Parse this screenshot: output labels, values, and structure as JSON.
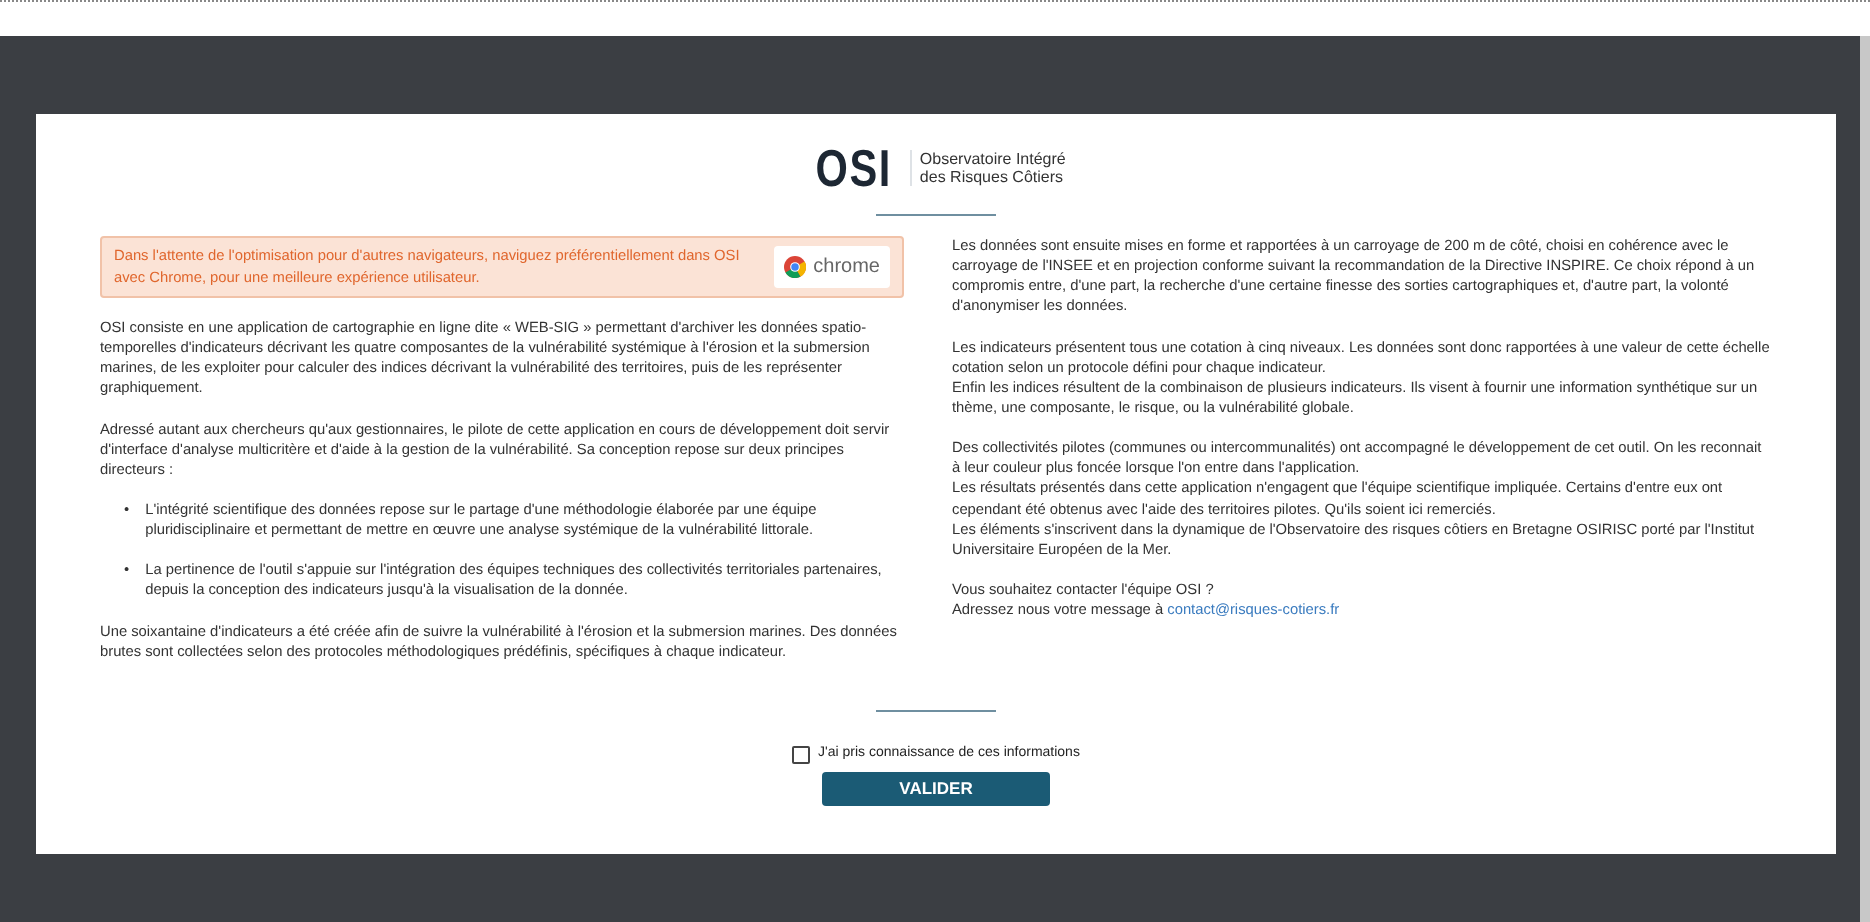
{
  "logo": {
    "acronym": "OSI",
    "name_line_1": "Observatoire Intégré",
    "name_line_2": "des Risques Côtiers"
  },
  "browser_notice": {
    "text": "Dans l'attente de l'optimisation pour d'autres navigateurs, naviguez préférentiellement dans OSI avec Chrome, pour une meilleure expérience utilisateur.",
    "badge": "chrome"
  },
  "left_column": [
    {
      "kind": "paragraph",
      "text": "OSI consiste en une application de cartographie en ligne dite « WEB-SIG » permettant d'archiver les données spatio-temporelles d'indicateurs décrivant les quatre composantes de la vulnérabilité systémique à l'érosion et la submersion marines, de les exploiter pour calculer des indices décrivant la vulnérabilité des territoires, puis de les représenter graphiquement."
    },
    {
      "kind": "paragraph",
      "text": "Adressé autant aux chercheurs qu'aux gestionnaires, le pilote de cette application en cours de développement doit servir d'interface d'analyse multicritère et d'aide à la gestion de la vulnérabilité. Sa conception repose sur deux principes directeurs :"
    },
    {
      "kind": "bullets",
      "marker": "•",
      "items": [
        "L'intégrité scientifique des données repose sur le partage d'une méthodologie élaborée par une équipe pluridisciplinaire et permettant de mettre en œuvre une analyse systémique de la vulnérabilité littorale.",
        "La pertinence de l'outil s'appuie sur l'intégration des équipes techniques des collectivités territoriales partenaires, depuis la conception des indicateurs jusqu'à la visualisation de la donnée."
      ]
    },
    {
      "kind": "paragraph",
      "text": "Une soixantaine d'indicateurs a été créée afin de suivre la vulnérabilité à l'érosion et la submersion marines. Des données brutes sont collectées selon des protocoles méthodologiques prédéfinis, spécifiques à chaque indicateur."
    }
  ],
  "right_column": [
    {
      "lines": [
        "Les données sont ensuite mises en forme et rapportées à un carroyage de 200 m de côté, choisi en cohérence avec le carroyage de l'INSEE et en projection conforme suivant la recommandation de la Directive INSPIRE. Ce choix répond à un compromis entre, d'une part, la recherche d'une certaine finesse des sorties cartographiques et, d'autre part, la volonté d'anonymiser les données."
      ]
    },
    {
      "lines": [
        "Les indicateurs présentent tous une cotation à cinq niveaux. Les données sont donc rapportées à une valeur de cette échelle cotation selon un protocole défini pour chaque indicateur.",
        "Enfin les indices résultent de la combinaison de plusieurs indicateurs. Ils visent à fournir une information synthétique sur un thème, une composante, le risque, ou la vulnérabilité globale."
      ]
    },
    {
      "lines": [
        "Des collectivités pilotes (communes ou intercommunalités) ont accompagné le développement de cet outil. On les reconnait à leur couleur plus foncée lorsque l'on entre dans l'application.",
        "Les résultats présentés dans cette application n'engagent que l'équipe scientifique impliquée. Certains d'entre eux ont cependant été obtenus avec l'aide des territoires pilotes. Qu'ils soient ici remerciés.",
        "Les éléments s'inscrivent dans la dynamique de l'Observatoire des risques côtiers en Bretagne OSIRISC porté par l'Institut Universitaire Européen de la Mer."
      ]
    },
    {
      "lines": [
        "Vous souhaitez contacter l'équipe OSI ?"
      ],
      "contact_prefix": "Adressez nous votre message à ",
      "contact_link": "contact@risques-cotiers.fr"
    }
  ],
  "acknowledge": {
    "label": "J'ai pris connaissance de ces informations",
    "checked": false
  },
  "submit_button": "VALIDER"
}
